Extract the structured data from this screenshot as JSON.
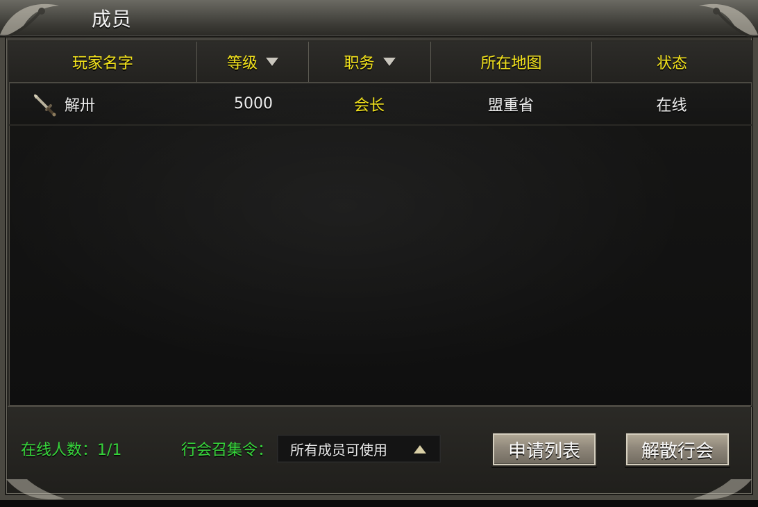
{
  "window": {
    "title": "成员"
  },
  "table": {
    "headers": [
      {
        "label": "玩家名字",
        "sortable": false
      },
      {
        "label": "等级",
        "sortable": true
      },
      {
        "label": "职务",
        "sortable": true
      },
      {
        "label": "所在地图",
        "sortable": false
      },
      {
        "label": "状态",
        "sortable": false
      }
    ],
    "rows": [
      {
        "icon": "sword-icon",
        "name": "解卅",
        "level": "5000",
        "role": "会长",
        "map": "盟重省",
        "status": "在线"
      }
    ]
  },
  "footer": {
    "online_label": "在线人数：1/1",
    "rally_label": "行会召集令：",
    "rally_value": "所有成员可使用",
    "apply_list_button": "申请列表",
    "disband_button": "解散行会"
  },
  "colors": {
    "header_text": "#f1e11a",
    "role_text": "#f1e11a",
    "online_green": "#35d33a",
    "body_text": "#eeeeee"
  },
  "icons": {
    "dropdown_caret": "caret-up-icon",
    "sort_caret": "caret-down-icon"
  }
}
